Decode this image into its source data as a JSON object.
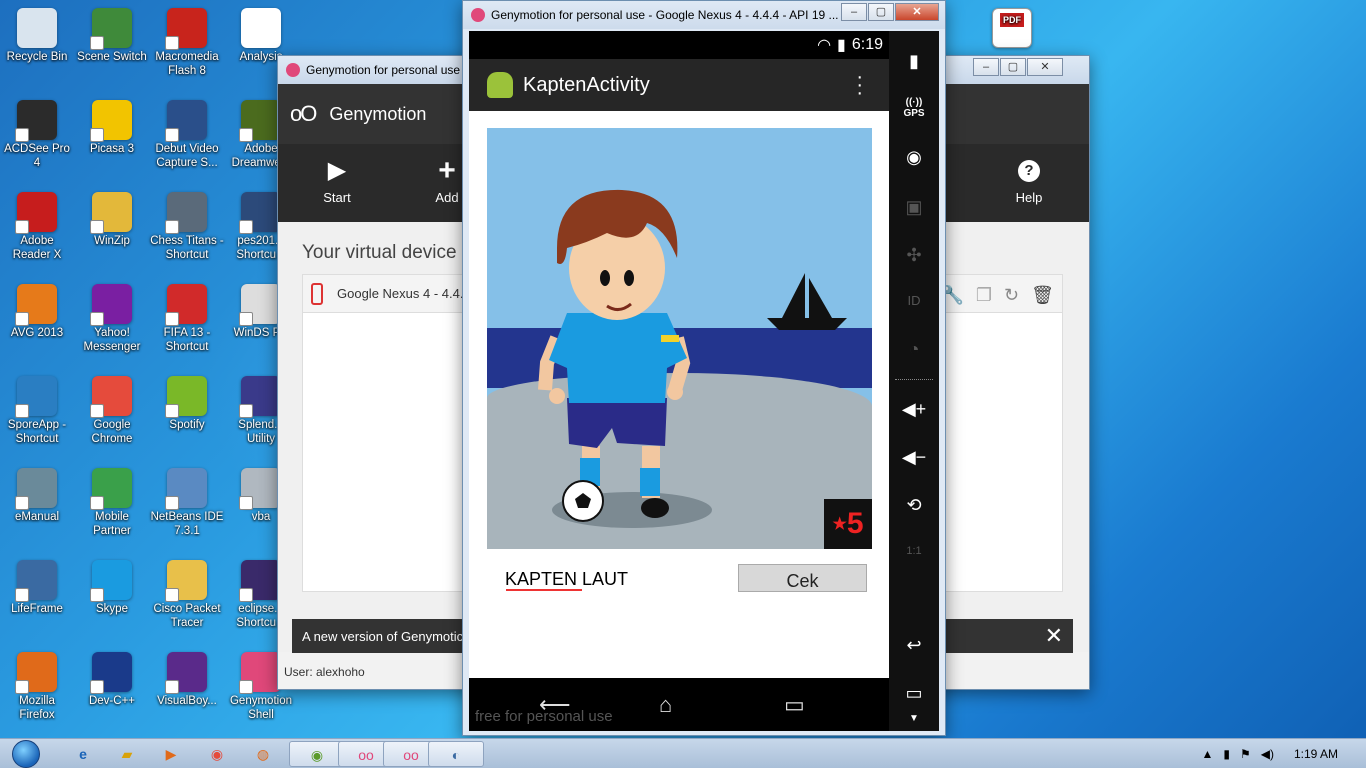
{
  "desktop": {
    "icons": [
      {
        "label": "Recycle Bin",
        "color": "#d9e4ee"
      },
      {
        "label": "Scene Switch",
        "color": "#3f8a3a"
      },
      {
        "label": "Macromedia Flash 8",
        "color": "#c8241c"
      },
      {
        "label": "Analysis",
        "color": "#ffffff"
      },
      {
        "label": "ACDSee Pro 4",
        "color": "#2b2b2b"
      },
      {
        "label": "Picasa 3",
        "color": "#f2c400"
      },
      {
        "label": "Debut Video Capture S...",
        "color": "#2a4f8a"
      },
      {
        "label": "Adobe Dreamwe...",
        "color": "#4b6b1e"
      },
      {
        "label": "Adobe Reader X",
        "color": "#c61d1d"
      },
      {
        "label": "WinZip",
        "color": "#e3b83a"
      },
      {
        "label": "Chess Titans - Shortcut",
        "color": "#5a6a7a"
      },
      {
        "label": "pes201... Shortcu...",
        "color": "#2c4a7a"
      },
      {
        "label": "AVG 2013",
        "color": "#e67a1a"
      },
      {
        "label": "Yahoo! Messenger",
        "color": "#7a1fa2"
      },
      {
        "label": "FIFA 13 - Shortcut",
        "color": "#d12a2a"
      },
      {
        "label": "WinDS P...",
        "color": "#dddddd"
      },
      {
        "label": "SporeApp - Shortcut",
        "color": "#2a7ec2"
      },
      {
        "label": "Google Chrome",
        "color": "#e54b3c"
      },
      {
        "label": "Spotify",
        "color": "#7ab828"
      },
      {
        "label": "Splend... Utility",
        "color": "#3a3a8a"
      },
      {
        "label": "eManual",
        "color": "#6a8a9a"
      },
      {
        "label": "Mobile Partner",
        "color": "#3aa04a"
      },
      {
        "label": "NetBeans IDE 7.3.1",
        "color": "#5a8ac2"
      },
      {
        "label": "vba",
        "color": "#b0b8c0"
      },
      {
        "label": "LifeFrame",
        "color": "#3a6aa2"
      },
      {
        "label": "Skype",
        "color": "#1a9be0"
      },
      {
        "label": "Cisco Packet Tracer",
        "color": "#e8c04a"
      },
      {
        "label": "eclipse... Shortcu...",
        "color": "#3a2a6a"
      },
      {
        "label": "Mozilla Firefox",
        "color": "#e06a1a"
      },
      {
        "label": "Dev-C++",
        "color": "#1a3a8a"
      },
      {
        "label": "VisualBoy...",
        "color": "#5a2a8a"
      },
      {
        "label": "Genymotion Shell",
        "color": "#e0487a"
      }
    ]
  },
  "geny_main": {
    "title": "Genymotion for personal use",
    "brand": "Genymotion",
    "logo": "oO",
    "toolbar": {
      "start": "Start",
      "add": "Add",
      "help": "Help",
      "help_glyph": "?"
    },
    "section_title": "Your virtual device",
    "device_row": "Google Nexus 4 - 4.4.",
    "notice": "A new version of Genymotic",
    "status": "User: alexhoho"
  },
  "emulator": {
    "title": "Genymotion for personal use - Google Nexus 4 - 4.4.4 - API 19 ...",
    "status_time": "6:19",
    "app_title": "KaptenActivity",
    "badge_number": "5",
    "input_value": "KAPTEN LAUT",
    "button_label": "Cek",
    "watermark": "free for personal use",
    "side": {
      "gps": "GPS",
      "id": "ID",
      "ratio": "1:1"
    }
  },
  "window_buttons": {
    "minimize": "‒",
    "maximize": "▢",
    "close": "✕"
  },
  "taskbar": {
    "time": "1:19 AM"
  }
}
